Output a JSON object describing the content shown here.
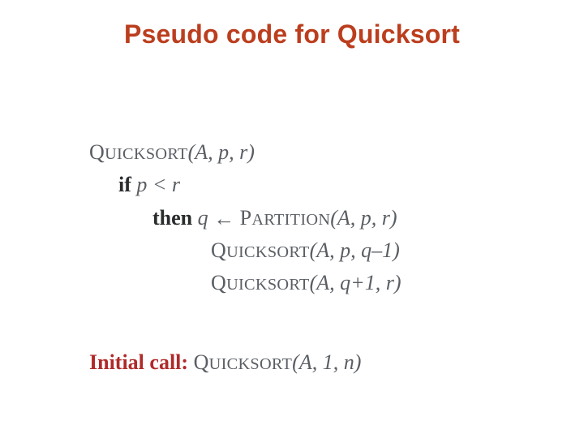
{
  "title": "Pseudo code for Quicksort",
  "proc": {
    "quicksort_first": "Q",
    "quicksort_rest": "UICKSORT",
    "partition_first": "P",
    "partition_rest": "ARTITION"
  },
  "args": {
    "apr": "(A, p, r)",
    "apq1": "(A, p, q–1)",
    "aq1r": "(A, q+1, r)",
    "a1n": "(A, 1, n)"
  },
  "kw": {
    "if": "if",
    "then": "then"
  },
  "cond": "p < r",
  "assign_lhs": "q",
  "arrow": "←",
  "initial_label": "Initial call:",
  "space": " "
}
